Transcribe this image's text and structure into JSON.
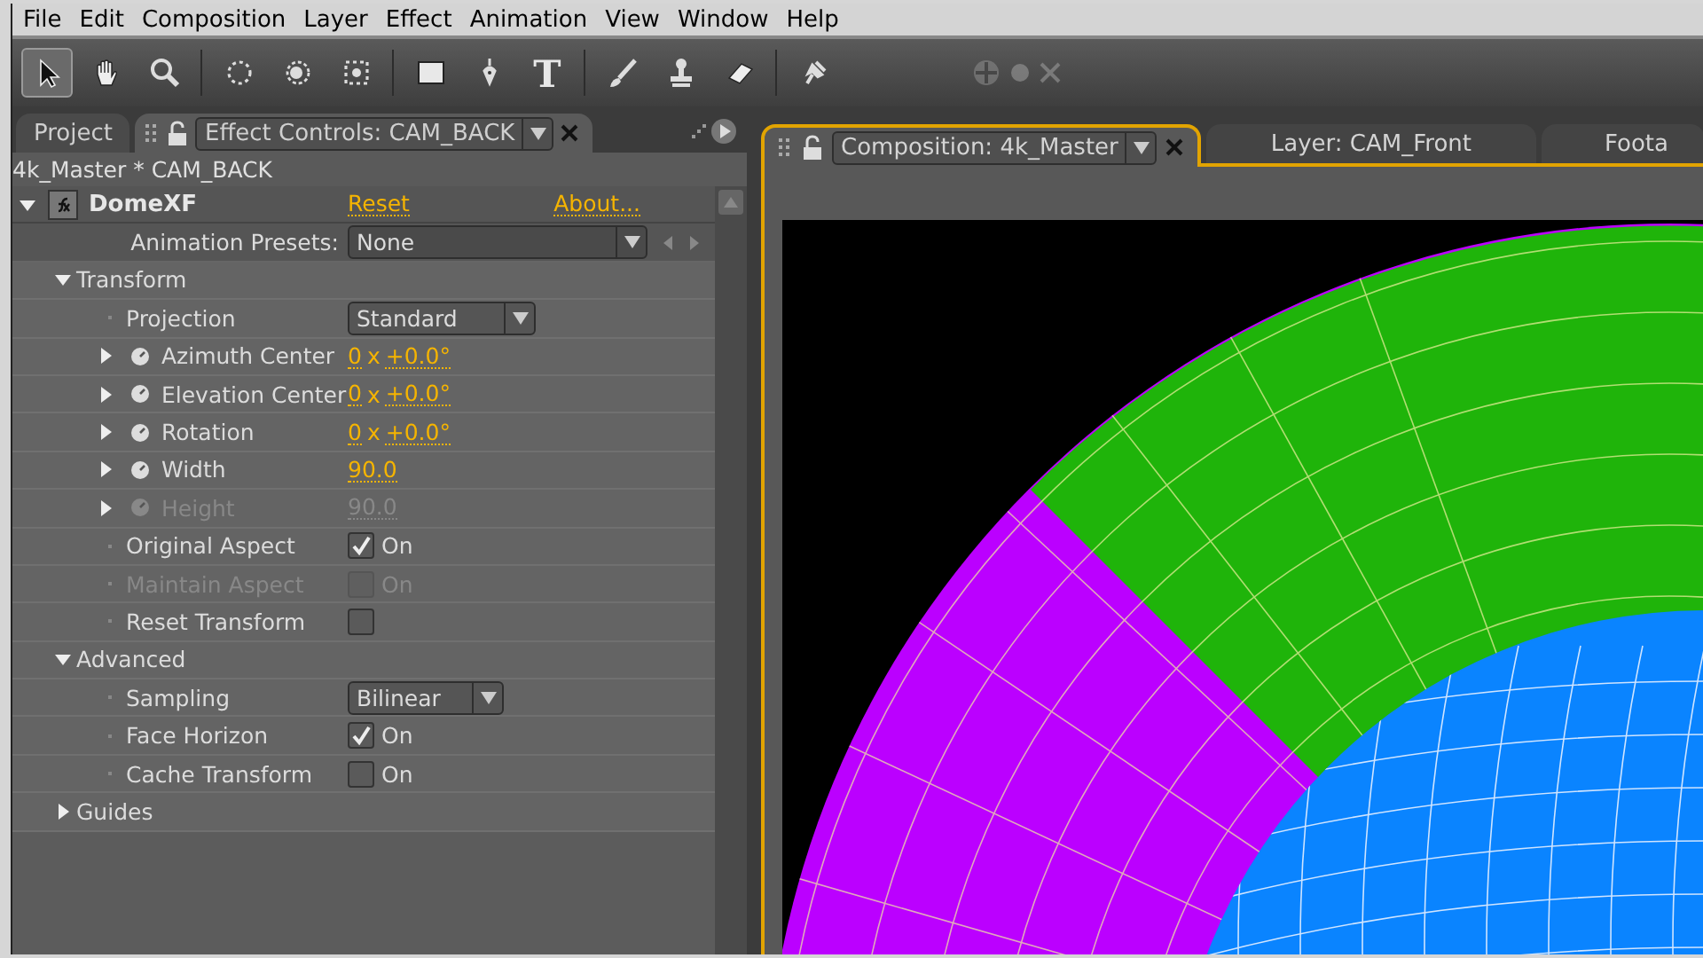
{
  "menu": [
    "File",
    "Edit",
    "Composition",
    "Layer",
    "Effect",
    "Animation",
    "View",
    "Window",
    "Help"
  ],
  "tools": [
    {
      "kind": "arrow",
      "selected": true
    },
    {
      "kind": "hand",
      "selected": false
    },
    {
      "kind": "zoom",
      "selected": false
    },
    {
      "kind": "rotate",
      "selected": false
    },
    {
      "kind": "orbit",
      "selected": false
    },
    {
      "kind": "pan",
      "selected": false
    },
    {
      "kind": "rect",
      "selected": false
    },
    {
      "kind": "pen",
      "selected": false
    },
    {
      "kind": "type",
      "glyph": "T",
      "selected": false
    },
    {
      "kind": "brush",
      "selected": false
    },
    {
      "kind": "stamp",
      "selected": false
    },
    {
      "kind": "eraser",
      "selected": false
    },
    {
      "kind": "pin",
      "selected": false
    }
  ],
  "left_tabs": [
    {
      "label": "Project",
      "selected": false
    },
    {
      "label": "Effect Controls: CAM_BACK",
      "selected": true
    }
  ],
  "breadcrumb": "4k_Master * CAM_BACK",
  "effect": {
    "name": "DomeXF",
    "expanded": true,
    "reset": "Reset",
    "about": "About...",
    "presets_label": "Animation Presets:",
    "presets_value": "None"
  },
  "rows": [
    {
      "kind": "group",
      "label": "Transform",
      "expanded": true,
      "children": [
        {
          "kind": "dropdown",
          "label": "Projection",
          "value": "Standard"
        },
        {
          "kind": "angle",
          "label": "Azimuth Center",
          "revolutions": "0",
          "unit": "x",
          "angle": "+0.0°",
          "disabled": false
        },
        {
          "kind": "angle",
          "label": "Elevation Center",
          "revolutions": "0",
          "unit": "x",
          "angle": "+0.0°",
          "disabled": false
        },
        {
          "kind": "angle",
          "label": "Rotation",
          "revolutions": "0",
          "unit": "x",
          "angle": "+0.0°",
          "disabled": false
        },
        {
          "kind": "number",
          "label": "Width",
          "value": "90.0",
          "disabled": false
        },
        {
          "kind": "number",
          "label": "Height",
          "value": "90.0",
          "disabled": true
        },
        {
          "kind": "checkbox",
          "label": "Original Aspect",
          "checked": true,
          "caption": "On",
          "disabled": false
        },
        {
          "kind": "checkbox",
          "label": "Maintain Aspect",
          "checked": false,
          "caption": "On",
          "disabled": true
        },
        {
          "kind": "checkbox",
          "label": "Reset Transform",
          "checked": false,
          "disabled": false
        }
      ]
    },
    {
      "kind": "group",
      "label": "Advanced",
      "expanded": true,
      "children": [
        {
          "kind": "dropdown",
          "label": "Sampling",
          "value": "Bilinear"
        },
        {
          "kind": "checkbox",
          "label": "Face Horizon",
          "checked": true,
          "caption": "On",
          "disabled": false
        },
        {
          "kind": "checkbox",
          "label": "Cache Transform",
          "checked": false,
          "caption": "On",
          "disabled": false
        }
      ]
    },
    {
      "kind": "group",
      "label": "Guides",
      "expanded": false,
      "children": []
    }
  ],
  "right_tabs": [
    {
      "label": "Composition: 4k_Master",
      "selected": true
    },
    {
      "label": "Layer: CAM_Front",
      "selected": false
    },
    {
      "label": "Foota",
      "selected": false
    }
  ]
}
